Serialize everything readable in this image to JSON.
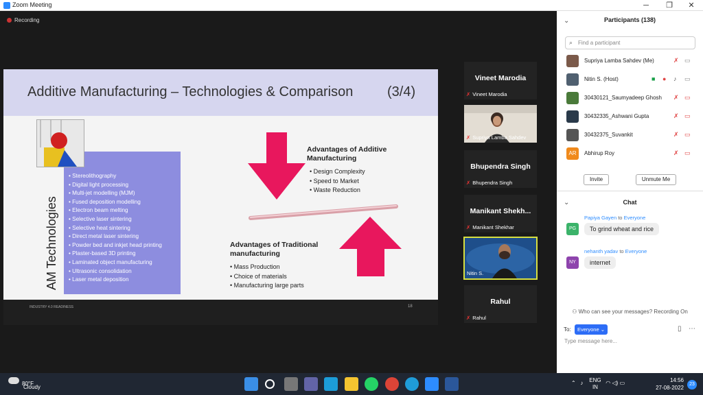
{
  "window": {
    "title": "Zoom Meeting",
    "minimize": "─",
    "restore": "❐",
    "close": "✕"
  },
  "recording": "Recording",
  "slide": {
    "title": "Additive Manufacturing – Technologies & Comparison",
    "page_label": "(3/4)",
    "vertical_label": "AM Technologies",
    "technologies": [
      "Stereolithography",
      "Digital light processing",
      "Multi-jet modelling (MJM)",
      "Fused deposition modelling",
      "Electron beam melting",
      "Selective laser sintering",
      "Selective heat sintering",
      "Direct metal laser sintering",
      "Powder bed and inkjet head printing",
      "Plaster-based 3D printing",
      "Laminated object manufacturing",
      "Ultrasonic consolidation",
      "Laser metal deposition"
    ],
    "additive_heading": "Advantages of Additive Manufacturing",
    "additive_items": [
      "Design Complexity",
      "Speed to Market",
      "Waste Reduction"
    ],
    "traditional_heading": "Advantages of Traditional manufacturing",
    "traditional_items": [
      "Mass Production",
      "Choice of materials",
      "Manufacturing large parts"
    ],
    "footer_left": "INDUSTRY 4.0 READINESS",
    "footer_right": "18"
  },
  "video_tiles": [
    {
      "big": "Vineet Marodia",
      "name": "Vineet Marodia"
    },
    {
      "big": "",
      "name": "Supriya Lamba  Sahdev"
    },
    {
      "big": "Bhupendra Singh",
      "name": "Bhupendra Singh"
    },
    {
      "big": "Manikant  Shekh...",
      "name": "Manikant Shekhar"
    },
    {
      "big": "",
      "name": "Nitin S."
    },
    {
      "big": "Rahul",
      "name": "Rahul"
    }
  ],
  "participants": {
    "header": "Participants (138)",
    "search_placeholder": "Find a participant",
    "list": [
      {
        "name": "Supriya Lamba  Sahdev (Me)",
        "avatar": ""
      },
      {
        "name": "Nitin S. (Host)",
        "avatar": ""
      },
      {
        "name": "30430121_Saumyadeep Ghosh",
        "avatar": ""
      },
      {
        "name": "30432335_Ashwani Gupta",
        "avatar": ""
      },
      {
        "name": "30432375_Suvankit",
        "avatar": ""
      },
      {
        "name": "Abhirup Roy",
        "avatar": "AR"
      }
    ],
    "invite": "Invite",
    "unmute_me": "Unmute Me"
  },
  "chat": {
    "header": "Chat",
    "messages": [
      {
        "from": "Papiya Gayen",
        "to_word": "to",
        "to": "Everyone",
        "avatar": "PG",
        "avatar_color": "#3bb36a",
        "text": "To grind wheat and rice"
      },
      {
        "from": "nehanth yadav",
        "to_word": "to",
        "to": "Everyone",
        "avatar": "NY",
        "avatar_color": "#8e44ad",
        "text": "internet"
      }
    ],
    "who_can_see": "Who can see your messages? Recording On",
    "to_label": "To:",
    "recipient": "Everyone ⌄",
    "type_placeholder": "Type message here..."
  },
  "taskbar": {
    "temp": "80°F",
    "condition": "Cloudy",
    "lang1": "ENG",
    "lang2": "IN",
    "time": "14:56",
    "date": "27-08-2022",
    "notifications": "23"
  }
}
